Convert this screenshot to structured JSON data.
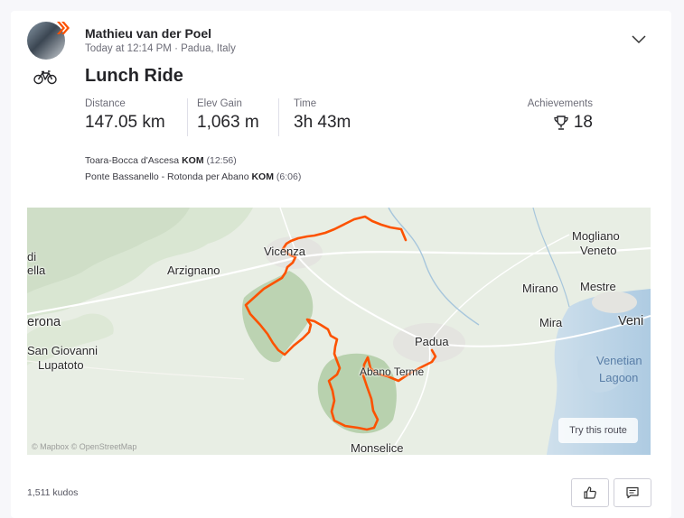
{
  "header": {
    "athlete_name": "Mathieu van der Poel",
    "meta": "Today at 12:14 PM · Padua, Italy"
  },
  "activity": {
    "title": "Lunch Ride",
    "stats": [
      {
        "label": "Distance",
        "value": "147.05 km"
      },
      {
        "label": "Elev Gain",
        "value": "1,063 m"
      },
      {
        "label": "Time",
        "value": "3h 43m"
      }
    ],
    "achievements": {
      "label": "Achievements",
      "value": "18"
    },
    "segments": [
      {
        "name": "Toara-Bocca d'Ascesa",
        "badge": "KOM",
        "time": "(12:56)"
      },
      {
        "name": "Ponte Bassanello - Rotonda per Abano",
        "badge": "KOM",
        "time": "(6:06)"
      }
    ]
  },
  "map": {
    "places": [
      {
        "name": "Vicenza"
      },
      {
        "name": "Arzignano"
      },
      {
        "name": "Padua"
      },
      {
        "name": "Abano Terme"
      },
      {
        "name": "Monselice"
      },
      {
        "name": "Mogliano"
      },
      {
        "name": "Veneto"
      },
      {
        "name": "Mestre"
      },
      {
        "name": "Mirano"
      },
      {
        "name": "Mira"
      },
      {
        "name": "Veni"
      },
      {
        "name": "Venetian"
      },
      {
        "name": "Lagoon"
      },
      {
        "name": "San Giovanni"
      },
      {
        "name": "Lupatoto"
      },
      {
        "name": "erona"
      },
      {
        "name": "di"
      },
      {
        "name": "ella"
      }
    ],
    "try_route_label": "Try this route",
    "attribution": "© Mapbox © OpenStreetMap",
    "route_color": "#fc5200"
  },
  "footer": {
    "kudos": "1,511 kudos"
  },
  "icons": {
    "sport": "bike-icon",
    "expand": "chevron-down-icon",
    "achievements": "trophy-icon",
    "kudos": "thumbs-up-icon",
    "comment": "comment-icon"
  }
}
